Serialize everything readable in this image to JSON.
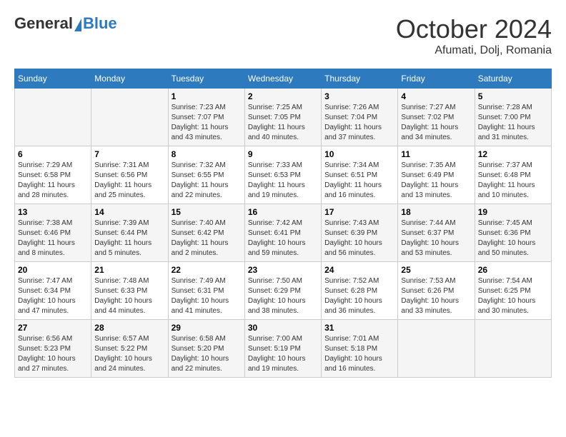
{
  "header": {
    "logo_general": "General",
    "logo_blue": "Blue",
    "month": "October 2024",
    "location": "Afumati, Dolj, Romania"
  },
  "days_of_week": [
    "Sunday",
    "Monday",
    "Tuesday",
    "Wednesday",
    "Thursday",
    "Friday",
    "Saturday"
  ],
  "weeks": [
    [
      {
        "day": "",
        "sunrise": "",
        "sunset": "",
        "daylight": ""
      },
      {
        "day": "",
        "sunrise": "",
        "sunset": "",
        "daylight": ""
      },
      {
        "day": "1",
        "sunrise": "Sunrise: 7:23 AM",
        "sunset": "Sunset: 7:07 PM",
        "daylight": "Daylight: 11 hours and 43 minutes."
      },
      {
        "day": "2",
        "sunrise": "Sunrise: 7:25 AM",
        "sunset": "Sunset: 7:05 PM",
        "daylight": "Daylight: 11 hours and 40 minutes."
      },
      {
        "day": "3",
        "sunrise": "Sunrise: 7:26 AM",
        "sunset": "Sunset: 7:04 PM",
        "daylight": "Daylight: 11 hours and 37 minutes."
      },
      {
        "day": "4",
        "sunrise": "Sunrise: 7:27 AM",
        "sunset": "Sunset: 7:02 PM",
        "daylight": "Daylight: 11 hours and 34 minutes."
      },
      {
        "day": "5",
        "sunrise": "Sunrise: 7:28 AM",
        "sunset": "Sunset: 7:00 PM",
        "daylight": "Daylight: 11 hours and 31 minutes."
      }
    ],
    [
      {
        "day": "6",
        "sunrise": "Sunrise: 7:29 AM",
        "sunset": "Sunset: 6:58 PM",
        "daylight": "Daylight: 11 hours and 28 minutes."
      },
      {
        "day": "7",
        "sunrise": "Sunrise: 7:31 AM",
        "sunset": "Sunset: 6:56 PM",
        "daylight": "Daylight: 11 hours and 25 minutes."
      },
      {
        "day": "8",
        "sunrise": "Sunrise: 7:32 AM",
        "sunset": "Sunset: 6:55 PM",
        "daylight": "Daylight: 11 hours and 22 minutes."
      },
      {
        "day": "9",
        "sunrise": "Sunrise: 7:33 AM",
        "sunset": "Sunset: 6:53 PM",
        "daylight": "Daylight: 11 hours and 19 minutes."
      },
      {
        "day": "10",
        "sunrise": "Sunrise: 7:34 AM",
        "sunset": "Sunset: 6:51 PM",
        "daylight": "Daylight: 11 hours and 16 minutes."
      },
      {
        "day": "11",
        "sunrise": "Sunrise: 7:35 AM",
        "sunset": "Sunset: 6:49 PM",
        "daylight": "Daylight: 11 hours and 13 minutes."
      },
      {
        "day": "12",
        "sunrise": "Sunrise: 7:37 AM",
        "sunset": "Sunset: 6:48 PM",
        "daylight": "Daylight: 11 hours and 10 minutes."
      }
    ],
    [
      {
        "day": "13",
        "sunrise": "Sunrise: 7:38 AM",
        "sunset": "Sunset: 6:46 PM",
        "daylight": "Daylight: 11 hours and 8 minutes."
      },
      {
        "day": "14",
        "sunrise": "Sunrise: 7:39 AM",
        "sunset": "Sunset: 6:44 PM",
        "daylight": "Daylight: 11 hours and 5 minutes."
      },
      {
        "day": "15",
        "sunrise": "Sunrise: 7:40 AM",
        "sunset": "Sunset: 6:42 PM",
        "daylight": "Daylight: 11 hours and 2 minutes."
      },
      {
        "day": "16",
        "sunrise": "Sunrise: 7:42 AM",
        "sunset": "Sunset: 6:41 PM",
        "daylight": "Daylight: 10 hours and 59 minutes."
      },
      {
        "day": "17",
        "sunrise": "Sunrise: 7:43 AM",
        "sunset": "Sunset: 6:39 PM",
        "daylight": "Daylight: 10 hours and 56 minutes."
      },
      {
        "day": "18",
        "sunrise": "Sunrise: 7:44 AM",
        "sunset": "Sunset: 6:37 PM",
        "daylight": "Daylight: 10 hours and 53 minutes."
      },
      {
        "day": "19",
        "sunrise": "Sunrise: 7:45 AM",
        "sunset": "Sunset: 6:36 PM",
        "daylight": "Daylight: 10 hours and 50 minutes."
      }
    ],
    [
      {
        "day": "20",
        "sunrise": "Sunrise: 7:47 AM",
        "sunset": "Sunset: 6:34 PM",
        "daylight": "Daylight: 10 hours and 47 minutes."
      },
      {
        "day": "21",
        "sunrise": "Sunrise: 7:48 AM",
        "sunset": "Sunset: 6:33 PM",
        "daylight": "Daylight: 10 hours and 44 minutes."
      },
      {
        "day": "22",
        "sunrise": "Sunrise: 7:49 AM",
        "sunset": "Sunset: 6:31 PM",
        "daylight": "Daylight: 10 hours and 41 minutes."
      },
      {
        "day": "23",
        "sunrise": "Sunrise: 7:50 AM",
        "sunset": "Sunset: 6:29 PM",
        "daylight": "Daylight: 10 hours and 38 minutes."
      },
      {
        "day": "24",
        "sunrise": "Sunrise: 7:52 AM",
        "sunset": "Sunset: 6:28 PM",
        "daylight": "Daylight: 10 hours and 36 minutes."
      },
      {
        "day": "25",
        "sunrise": "Sunrise: 7:53 AM",
        "sunset": "Sunset: 6:26 PM",
        "daylight": "Daylight: 10 hours and 33 minutes."
      },
      {
        "day": "26",
        "sunrise": "Sunrise: 7:54 AM",
        "sunset": "Sunset: 6:25 PM",
        "daylight": "Daylight: 10 hours and 30 minutes."
      }
    ],
    [
      {
        "day": "27",
        "sunrise": "Sunrise: 6:56 AM",
        "sunset": "Sunset: 5:23 PM",
        "daylight": "Daylight: 10 hours and 27 minutes."
      },
      {
        "day": "28",
        "sunrise": "Sunrise: 6:57 AM",
        "sunset": "Sunset: 5:22 PM",
        "daylight": "Daylight: 10 hours and 24 minutes."
      },
      {
        "day": "29",
        "sunrise": "Sunrise: 6:58 AM",
        "sunset": "Sunset: 5:20 PM",
        "daylight": "Daylight: 10 hours and 22 minutes."
      },
      {
        "day": "30",
        "sunrise": "Sunrise: 7:00 AM",
        "sunset": "Sunset: 5:19 PM",
        "daylight": "Daylight: 10 hours and 19 minutes."
      },
      {
        "day": "31",
        "sunrise": "Sunrise: 7:01 AM",
        "sunset": "Sunset: 5:18 PM",
        "daylight": "Daylight: 10 hours and 16 minutes."
      },
      {
        "day": "",
        "sunrise": "",
        "sunset": "",
        "daylight": ""
      },
      {
        "day": "",
        "sunrise": "",
        "sunset": "",
        "daylight": ""
      }
    ]
  ]
}
